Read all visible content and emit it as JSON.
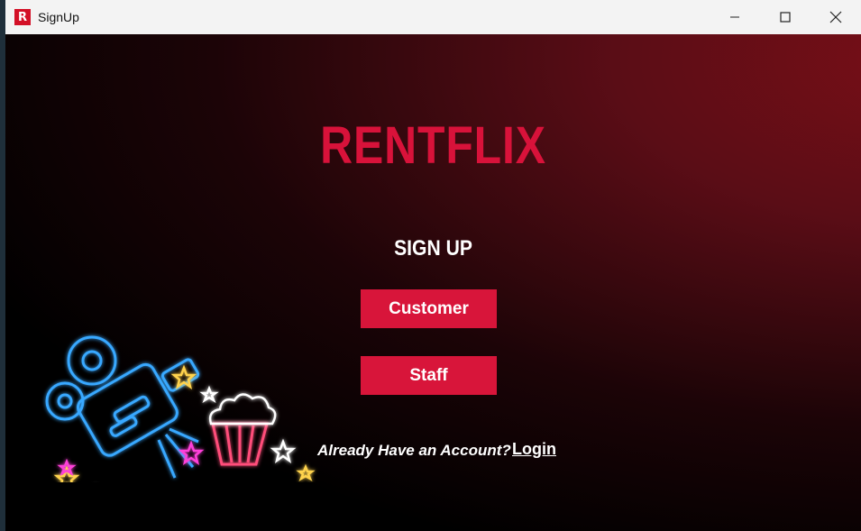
{
  "window": {
    "title": "SignUp",
    "app_icon_letter": "R"
  },
  "main": {
    "logo": "RENTFLIX",
    "heading": "SIGN UP",
    "customer_button": "Customer",
    "staff_button": "Staff",
    "account_prompt": "Already Have an Account?",
    "login_link": "Login"
  },
  "colors": {
    "brand": "#d8123a",
    "background": "#000000",
    "accent_gradient": "#7a0e17"
  },
  "icons": [
    "app-logo-icon",
    "minimize-icon",
    "maximize-icon",
    "close-icon",
    "neon-camera-icon",
    "popcorn-icon",
    "star-icon"
  ]
}
